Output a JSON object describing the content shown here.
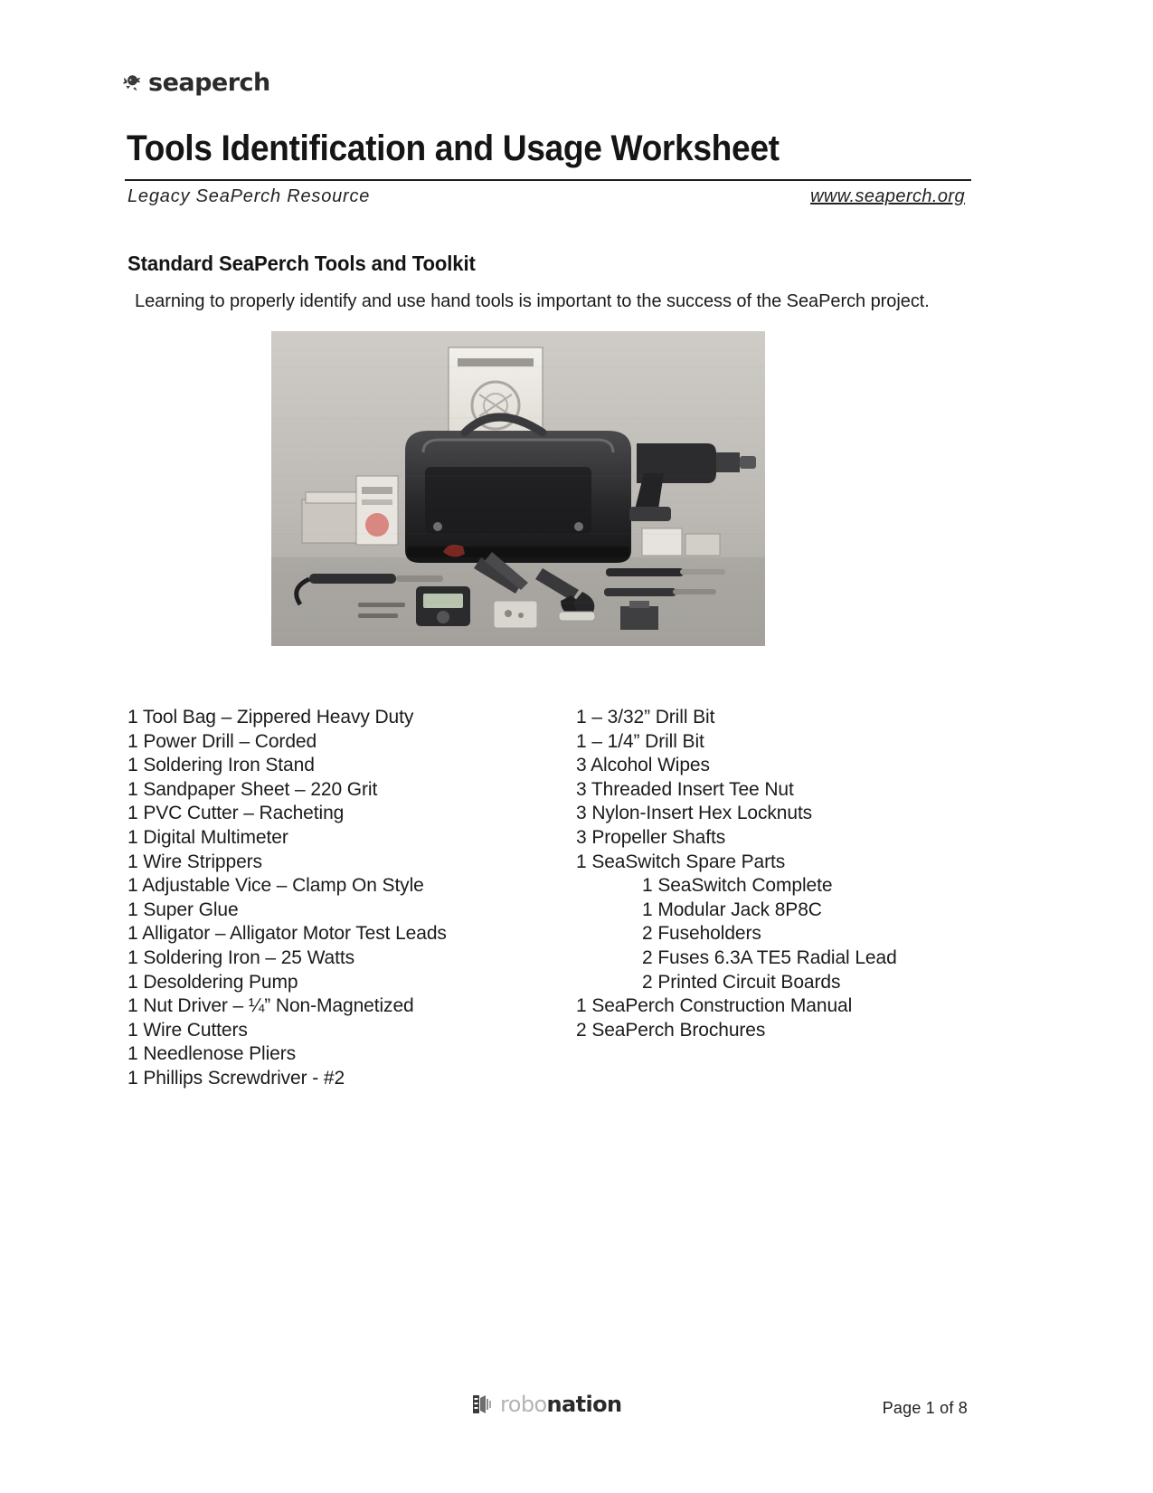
{
  "brand": {
    "logo_icon": "seaperch-fish-icon",
    "wordmark": "seaperch"
  },
  "header": {
    "title": "Tools Identification and Usage Worksheet",
    "subtitle": "Legacy SeaPerch Resource",
    "website": "www.seaperch.org"
  },
  "section": {
    "heading": "Standard SeaPerch Tools and Toolkit",
    "intro": "Learning to properly identify and use hand tools is important to the success of the SeaPerch project."
  },
  "photo": {
    "alt": "SeaPerch standard toolkit contents laid out with tool bag, power drill, soldering iron, pliers, cutters and small parts"
  },
  "toolkit": {
    "left_column": [
      "1 Tool Bag – Zippered Heavy Duty",
      "1 Power Drill – Corded",
      "1 Soldering Iron Stand",
      "1 Sandpaper Sheet – 220 Grit",
      "1 PVC Cutter – Racheting",
      "1 Digital Multimeter",
      "1 Wire Strippers",
      "1 Adjustable Vice – Clamp On Style",
      "1 Super Glue",
      "1 Alligator – Alligator Motor Test Leads",
      "1 Soldering Iron – 25 Watts",
      "1 Desoldering Pump",
      "1 Nut Driver – ¼” Non-Magnetized",
      "1 Wire Cutters",
      "1 Needlenose Pliers",
      "1 Phillips Screwdriver - #2"
    ],
    "right_column": [
      {
        "text": "1 – 3/32” Drill Bit",
        "indent": false
      },
      {
        "text": "1 – 1/4” Drill Bit",
        "indent": false
      },
      {
        "text": "3 Alcohol Wipes",
        "indent": false
      },
      {
        "text": "3 Threaded Insert Tee Nut",
        "indent": false
      },
      {
        "text": "3 Nylon-Insert Hex Locknuts",
        "indent": false
      },
      {
        "text": "3 Propeller Shafts",
        "indent": false
      },
      {
        "text": "1 SeaSwitch Spare Parts",
        "indent": false
      },
      {
        "text": "1 SeaSwitch Complete",
        "indent": true
      },
      {
        "text": "1 Modular Jack 8P8C",
        "indent": true
      },
      {
        "text": "2 Fuseholders",
        "indent": true
      },
      {
        "text": "2 Fuses 6.3A TE5 Radial Lead",
        "indent": true
      },
      {
        "text": "2 Printed Circuit Boards",
        "indent": true
      },
      {
        "text": "1 SeaPerch Construction Manual",
        "indent": false
      },
      {
        "text": "2 SeaPerch Brochures",
        "indent": false
      }
    ]
  },
  "footer": {
    "logo_icon": "robonation-logo-icon",
    "logo_text_light": "robo",
    "logo_text_bold": "nation",
    "page_label": "Page 1 of 8"
  }
}
